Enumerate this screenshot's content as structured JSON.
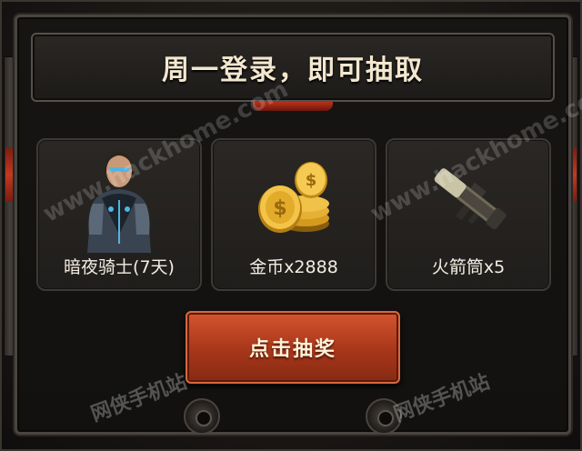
{
  "title": "周一登录，即可抽取",
  "rewards": [
    {
      "label": "暗夜骑士(7天)",
      "icon": "armored-knight-icon"
    },
    {
      "label": "金币x2888",
      "icon": "gold-coins-icon"
    },
    {
      "label": "火箭筒x5",
      "icon": "rocket-launcher-icon"
    }
  ],
  "draw_button": {
    "label": "点击抽奖"
  },
  "watermarks": {
    "url_1": "www.hackhome.com",
    "url_2": "www.hackhome.com",
    "site_1": "网侠手机站",
    "site_2": "网侠手机站"
  },
  "colors": {
    "accent_red": "#c2391f",
    "title_text": "#f3e7cf",
    "button": "#a7361a"
  }
}
